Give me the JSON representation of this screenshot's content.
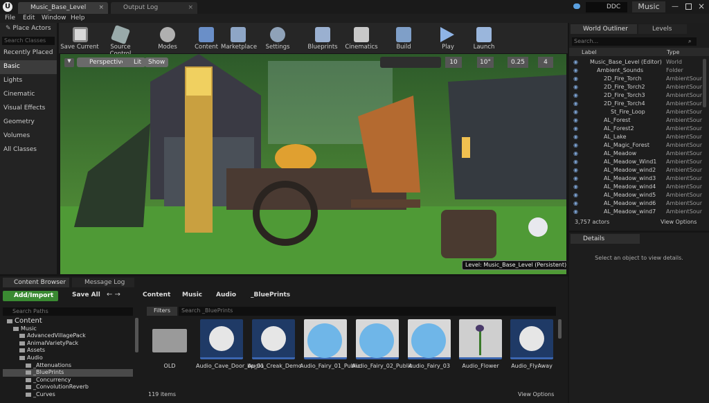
{
  "title_tabs": [
    "Music_Base_Level",
    "Output Log"
  ],
  "top_right": {
    "ddc": "DDC",
    "project": "Music"
  },
  "menu": [
    "File",
    "Edit",
    "Window",
    "Help"
  ],
  "place_actors": {
    "title": "Place Actors",
    "search_placeholder": "Search Classes",
    "items": [
      "Recently Placed",
      "Basic",
      "Lights",
      "Cinematic",
      "Visual Effects",
      "Geometry",
      "Volumes",
      "All Classes"
    ]
  },
  "toolbar": [
    "Save Current",
    "Source Control",
    "Modes",
    "Content",
    "Marketplace",
    "Settings",
    "Blueprints",
    "Cinematics",
    "Build",
    "Play",
    "Launch"
  ],
  "viewport": {
    "perspective": "Perspective",
    "lit": "Lit",
    "show": "Show",
    "grid": "10",
    "angle": "10°",
    "scale": "0.25",
    "cam": "4",
    "level_label": "Level:  Music_Base_Level (Persistent)"
  },
  "outliner": {
    "tab1": "World Outliner",
    "tab2": "Levels",
    "search_placeholder": "Search...",
    "col_label": "Label",
    "col_type": "Type",
    "rows": [
      {
        "label": "Music_Base_Level (Editor)",
        "type": "World",
        "indent": 0
      },
      {
        "label": "Ambient_Sounds",
        "type": "Folder",
        "indent": 1
      },
      {
        "label": "2D_Fire_Torch",
        "type": "AmbientSoun",
        "indent": 2
      },
      {
        "label": "2D_Fire_Torch2",
        "type": "AmbientSoun",
        "indent": 2
      },
      {
        "label": "2D_Fire_Torch3",
        "type": "AmbientSoun",
        "indent": 2
      },
      {
        "label": "2D_Fire_Torch4",
        "type": "AmbientSoun",
        "indent": 2
      },
      {
        "label": "St_Fire_Loop",
        "type": "AmbientSoun",
        "indent": 3
      },
      {
        "label": "AL_Forest",
        "type": "AmbientSoun",
        "indent": 2
      },
      {
        "label": "AL_Forest2",
        "type": "AmbientSoun",
        "indent": 2
      },
      {
        "label": "AL_Lake",
        "type": "AmbientSoun",
        "indent": 2
      },
      {
        "label": "AL_Magic_Forest",
        "type": "AmbientSoun",
        "indent": 2
      },
      {
        "label": "AL_Meadow",
        "type": "AmbientSoun",
        "indent": 2
      },
      {
        "label": "AL_Meadow_Wind1",
        "type": "AmbientSoun",
        "indent": 2
      },
      {
        "label": "AL_Meadow_wind2",
        "type": "AmbientSoun",
        "indent": 2
      },
      {
        "label": "AL_Meadow_wind3",
        "type": "AmbientSoun",
        "indent": 2
      },
      {
        "label": "AL_Meadow_wind4",
        "type": "AmbientSoun",
        "indent": 2
      },
      {
        "label": "AL_Meadow_wind5",
        "type": "AmbientSoun",
        "indent": 2
      },
      {
        "label": "AL_Meadow_wind6",
        "type": "AmbientSoun",
        "indent": 2
      },
      {
        "label": "AL_Meadow_wind7",
        "type": "AmbientSoun",
        "indent": 2
      }
    ],
    "actor_count": "3,757 actors",
    "view_options": "View Options"
  },
  "details": {
    "title": "Details",
    "empty": "Select an object to view details."
  },
  "content_browser": {
    "tab1": "Content Browser",
    "tab2": "Message Log",
    "add_import": "Add/Import",
    "save_all": "Save All",
    "path": [
      "Content",
      "Music",
      "Audio",
      "_BluePrints"
    ],
    "search_paths": "Search Paths",
    "filters": "Filters",
    "search_placeholder": "Search _BluePrints",
    "tree": [
      {
        "label": "Content",
        "indent": 0,
        "big": true
      },
      {
        "label": "Music",
        "indent": 1
      },
      {
        "label": "AdvancedVillagePack",
        "indent": 2
      },
      {
        "label": "AnimalVarietyPack",
        "indent": 2
      },
      {
        "label": "Assets",
        "indent": 2
      },
      {
        "label": "Audio",
        "indent": 2
      },
      {
        "label": "_Attenuations",
        "indent": 3
      },
      {
        "label": "_BluePrints",
        "indent": 3
      },
      {
        "label": "_Concurrency",
        "indent": 3
      },
      {
        "label": "_ConvolutionReverb",
        "indent": 3
      },
      {
        "label": "_Curves",
        "indent": 3
      }
    ],
    "assets": [
      "OLD",
      "Audio_Cave_Door_bp_01",
      "Audio_Creak_Demo",
      "Audio_Fairy_01_Public",
      "Audio_Fairy_02_Public",
      "Audio_Fairy_03",
      "Audio_Flower",
      "Audio_FlyAway"
    ],
    "item_count": "119 items",
    "view_options": "View Options"
  }
}
